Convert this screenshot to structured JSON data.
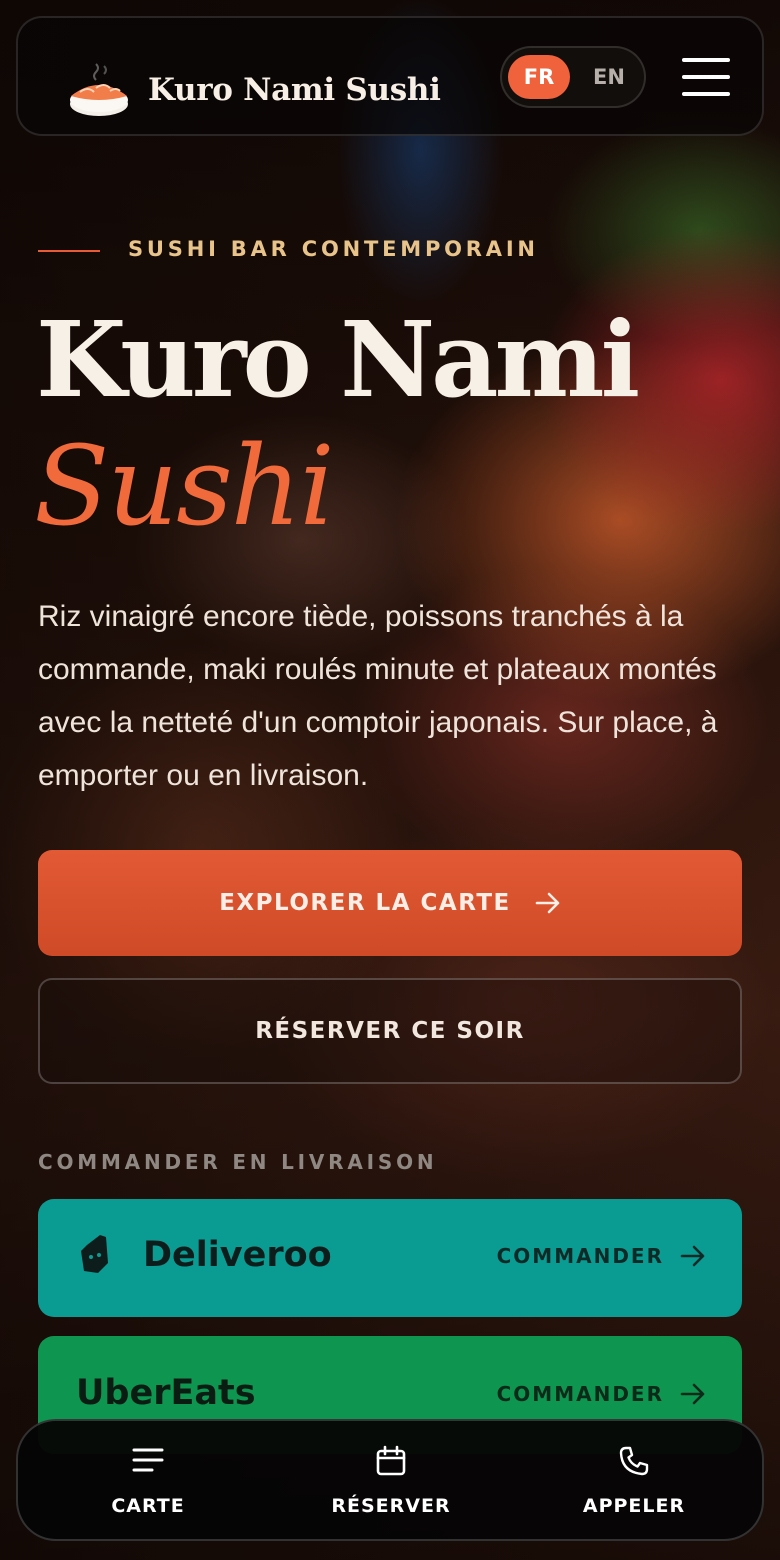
{
  "header": {
    "brand": "Kuro Nami Sushi",
    "lang": {
      "fr": "FR",
      "en": "EN",
      "active": "FR"
    }
  },
  "hero": {
    "eyebrow": "SUSHI BAR CONTEMPORAIN",
    "title_line1": "Kuro Nami",
    "title_line2": "Sushi",
    "description": "Riz vinaigré encore tiède, poissons tranchés à la commande, maki roulés minute et plateaux montés avec la netteté d'un comptoir japonais. Sur place, à emporter ou en livraison.",
    "primary_cta": "EXPLORER LA CARTE",
    "secondary_cta": "RÉSERVER CE SOIR"
  },
  "delivery": {
    "section_label": "COMMANDER EN LIVRAISON",
    "services": [
      {
        "name": "Deliveroo",
        "cta": "COMMANDER",
        "color": "#0a9c93"
      },
      {
        "name": "UberEats",
        "cta": "COMMANDER",
        "color": "#0e9651"
      }
    ]
  },
  "bottom_nav": {
    "items": [
      {
        "label": "CARTE",
        "icon": "menu-lines-icon"
      },
      {
        "label": "RÉSERVER",
        "icon": "calendar-icon"
      },
      {
        "label": "APPELER",
        "icon": "phone-icon"
      }
    ]
  },
  "colors": {
    "accent": "#f0623b",
    "gold": "#e8c48a",
    "deliveroo": "#0a9c93",
    "ubereats": "#0e9651"
  }
}
